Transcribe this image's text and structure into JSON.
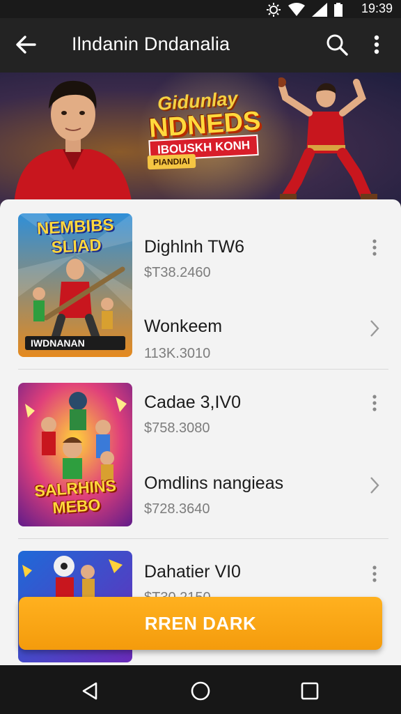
{
  "status_bar": {
    "time": "19:39"
  },
  "app_bar": {
    "title": "Ilndanin Dndanalia"
  },
  "hero": {
    "line1": "Gidunlay",
    "line2": "NDNEDS",
    "ribbon": "IBOUSKH KONH",
    "badge": "PIANDIAI"
  },
  "items": [
    {
      "thumb_text": "NEMBIBS SLIAD",
      "thumb_footer": "IWDNANAN",
      "title": "Dighlnh TW6",
      "price": "$T38.2460",
      "subtitle": "Wonkeem",
      "subprice": "113K.3010"
    },
    {
      "thumb_text": "SALRHINS MEBO",
      "title": "Cadae 3,IV0",
      "price": "$758.3080",
      "subtitle": "Omdlins nangieas",
      "subprice": "$728.3640"
    },
    {
      "title": "Dahatier VI0",
      "price": "$T30.2150"
    }
  ],
  "cta": {
    "label": "RREN DARK"
  },
  "colors": {
    "accent": "#f7a515",
    "hero_title": "#ffd93d",
    "ribbon": "#d81e2a"
  }
}
